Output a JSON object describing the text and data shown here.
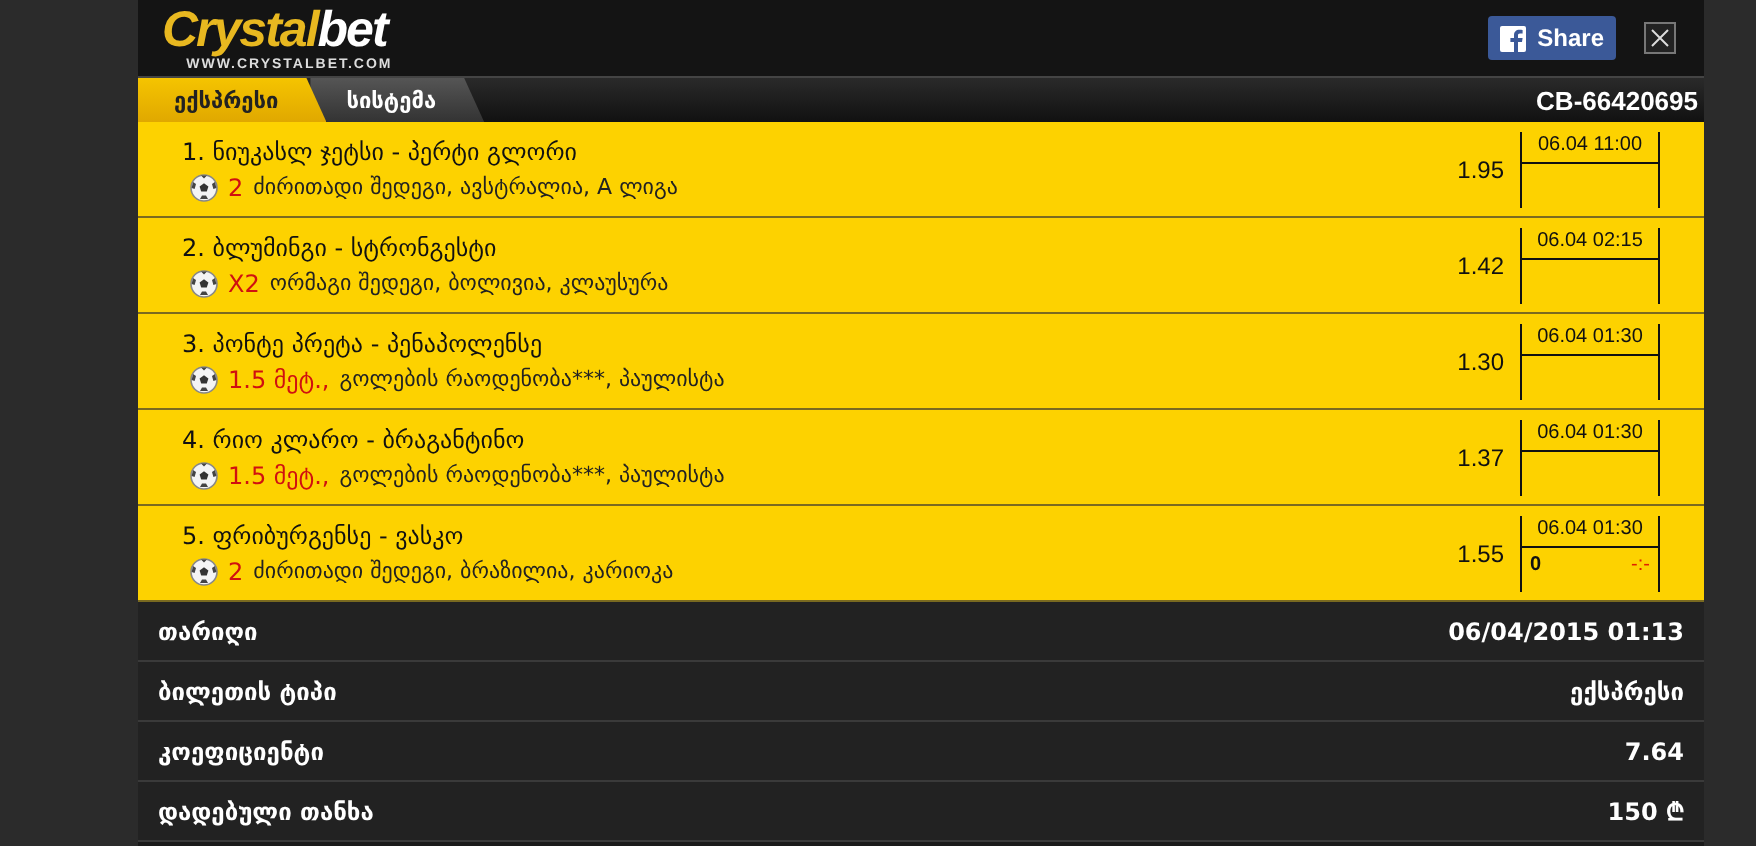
{
  "header": {
    "logo": {
      "main": "Crystal",
      "accent": "bet",
      "url": "WWW.CRYSTALBET.COM"
    },
    "share_button": "Share"
  },
  "tabs": [
    {
      "label": "ექსპრესი",
      "selected": true
    },
    {
      "label": "სისტემა",
      "selected": false
    }
  ],
  "ticket_id": "CB-66420695",
  "events": [
    {
      "title": "1. ნიუკასლ ჯეტსი - პერტი გლორი",
      "pick": "2",
      "market": "ძირითადი შედეგი, ავსტრალია, A ლიგა",
      "odds": "1.95",
      "date": "06.04 11:00"
    },
    {
      "title": "2. ბლუმინგი - სტრონგესტი",
      "pick": "X2",
      "market": "ორმაგი შედეგი, ბოლივია, კლაუსურა",
      "odds": "1.42",
      "date": "06.04 02:15"
    },
    {
      "title": "3. პონტე პრეტა - პენაპოლენსე",
      "pick": "1.5 მეტ.,",
      "market": "გოლების რაოდენობა***, პაულისტა",
      "odds": "1.30",
      "date": "06.04 01:30"
    },
    {
      "title": "4. რიო კლარო - ბრაგანტინო",
      "pick": "1.5 მეტ.,",
      "market": "გოლების რაოდენობა***, პაულისტა",
      "odds": "1.37",
      "date": "06.04 01:30"
    },
    {
      "title": "5. ფრიბურგენსე - ვასკო",
      "pick": "2",
      "market": "ძირითადი შედეგი, ბრაზილია, კარიოკა",
      "odds": "1.55",
      "date": "06.04 01:30",
      "score": "0",
      "result": "-:-"
    }
  ],
  "summary": [
    {
      "label": "თარიღი",
      "value": "06/04/2015 01:13"
    },
    {
      "label": "ბილეთის ტიპი",
      "value": "ექსპრესი"
    },
    {
      "label": "კოეფიციენტი",
      "value": "7.64"
    },
    {
      "label": "დადებული თანხა",
      "value": "150 ₾"
    }
  ]
}
